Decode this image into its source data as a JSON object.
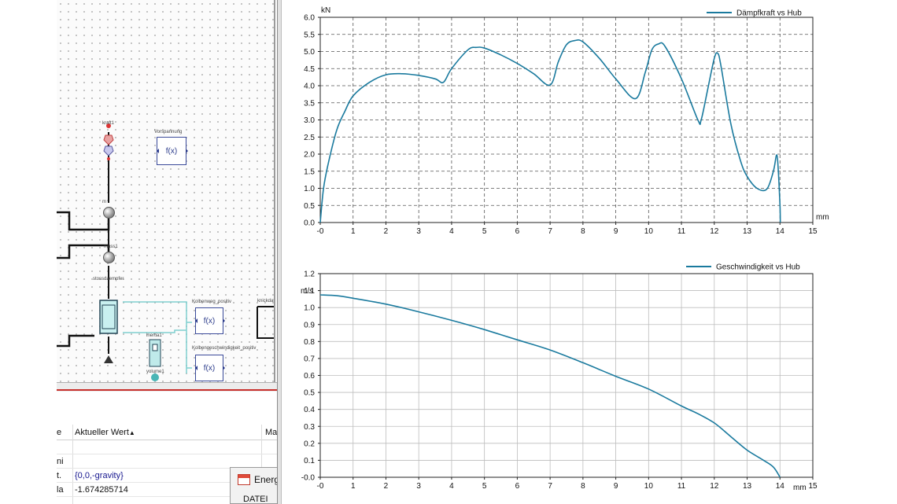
{
  "diagram": {
    "blocks": [
      {
        "id": "vorspannung",
        "label": "Vorspannung",
        "text": "f(x)"
      },
      {
        "id": "kolbenweg",
        "label": "Kolbenweg_positiv",
        "text": "f(x)"
      },
      {
        "id": "kolbengeschwindigkeit",
        "label": "Kolbengeschwindigkeit_positiv",
        "text": "f(x)"
      }
    ],
    "labels": {
      "mass1": "mass1",
      "stossdaempfer": "stossdaempfer",
      "inertia1": "inertia1",
      "volume1": "volume1",
      "kraft1": "kraft1",
      "knickdaten": "knickdat"
    }
  },
  "property_table": {
    "headers": {
      "name": "e",
      "value": "Aktueller Wert",
      "max": "Ma",
      "sort_icon": "sort-ascending-triangle"
    },
    "rows": [
      {
        "name": "",
        "value": ""
      },
      {
        "name": "ni",
        "value": ""
      },
      {
        "name": "t.",
        "value": "{0,0,-gravity}"
      },
      {
        "name": "la",
        "value": "-1.674285714"
      }
    ]
  },
  "popup": {
    "title": "Energ",
    "menu": "DATEI"
  },
  "chart_data": [
    {
      "type": "line",
      "title": "",
      "legend": [
        "Dämpfkraft vs Hub"
      ],
      "legend_position": "top-right",
      "xlabel": "mm",
      "ylabel": "kN",
      "xlim": [
        0,
        15
      ],
      "ylim": [
        0,
        6.0
      ],
      "grid": true,
      "grid_style": "dashed",
      "color": "#1a7a9e",
      "x_ticks": [
        "-0",
        "1",
        "2",
        "3",
        "4",
        "5",
        "6",
        "7",
        "8",
        "9",
        "10",
        "11",
        "12",
        "13",
        "14",
        "15"
      ],
      "y_ticks": [
        "0.0",
        "0.5",
        "1.0",
        "1.5",
        "2.0",
        "2.5",
        "3.0",
        "3.5",
        "4.0",
        "4.5",
        "5.0",
        "5.5",
        "6.0"
      ],
      "series": [
        {
          "name": "Dämpfkraft vs Hub",
          "x": [
            0,
            0.1,
            0.25,
            0.5,
            0.75,
            1.0,
            1.5,
            2.0,
            2.5,
            3.0,
            3.5,
            3.75,
            4.0,
            4.5,
            4.75,
            5.0,
            5.5,
            6.0,
            6.5,
            7.0,
            7.25,
            7.5,
            7.75,
            8.0,
            8.5,
            9.0,
            9.6,
            9.9,
            10.1,
            10.3,
            10.5,
            11.0,
            11.5,
            11.6,
            11.8,
            12.0,
            12.1,
            12.2,
            12.5,
            12.8,
            13.0,
            13.3,
            13.6,
            13.8,
            13.9,
            13.95,
            14.0,
            14.01
          ],
          "y": [
            0,
            1.0,
            1.75,
            2.7,
            3.25,
            3.7,
            4.1,
            4.32,
            4.35,
            4.3,
            4.2,
            4.1,
            4.5,
            5.05,
            5.12,
            5.1,
            4.9,
            4.65,
            4.35,
            4.02,
            4.7,
            5.2,
            5.32,
            5.28,
            4.8,
            4.2,
            3.62,
            4.4,
            5.05,
            5.22,
            5.15,
            4.2,
            3.0,
            3.0,
            3.9,
            4.8,
            4.95,
            4.6,
            2.9,
            1.8,
            1.35,
            1.0,
            0.98,
            1.5,
            1.98,
            1.5,
            0.5,
            0
          ]
        }
      ]
    },
    {
      "type": "line",
      "title": "",
      "legend": [
        "Geschwindigkeit vs Hub"
      ],
      "legend_position": "top-right",
      "xlabel": "mm",
      "ylabel": "m/s",
      "xlim": [
        0,
        15
      ],
      "ylim": [
        0,
        1.2
      ],
      "grid": true,
      "grid_style": "solid",
      "color": "#1a7a9e",
      "x_ticks": [
        "-0",
        "1",
        "2",
        "3",
        "4",
        "5",
        "6",
        "7",
        "8",
        "9",
        "10",
        "11",
        "12",
        "13",
        "14",
        "15"
      ],
      "y_ticks": [
        "-0.0",
        "0.1",
        "0.2",
        "0.3",
        "0.4",
        "0.5",
        "0.6",
        "0.7",
        "0.8",
        "0.9",
        "1.0",
        "1.1",
        "1.2"
      ],
      "series": [
        {
          "name": "Geschwindigkeit vs Hub",
          "x": [
            0,
            0.5,
            1.0,
            2.0,
            3.0,
            4.0,
            5.0,
            6.0,
            7.0,
            8.0,
            9.0,
            10.0,
            11.0,
            11.5,
            12.0,
            12.5,
            13.0,
            13.5,
            13.8,
            14.0
          ],
          "y": [
            1.075,
            1.07,
            1.055,
            1.02,
            0.975,
            0.925,
            0.87,
            0.81,
            0.75,
            0.675,
            0.595,
            0.52,
            0.42,
            0.375,
            0.32,
            0.24,
            0.16,
            0.1,
            0.06,
            0.0
          ]
        }
      ]
    }
  ]
}
